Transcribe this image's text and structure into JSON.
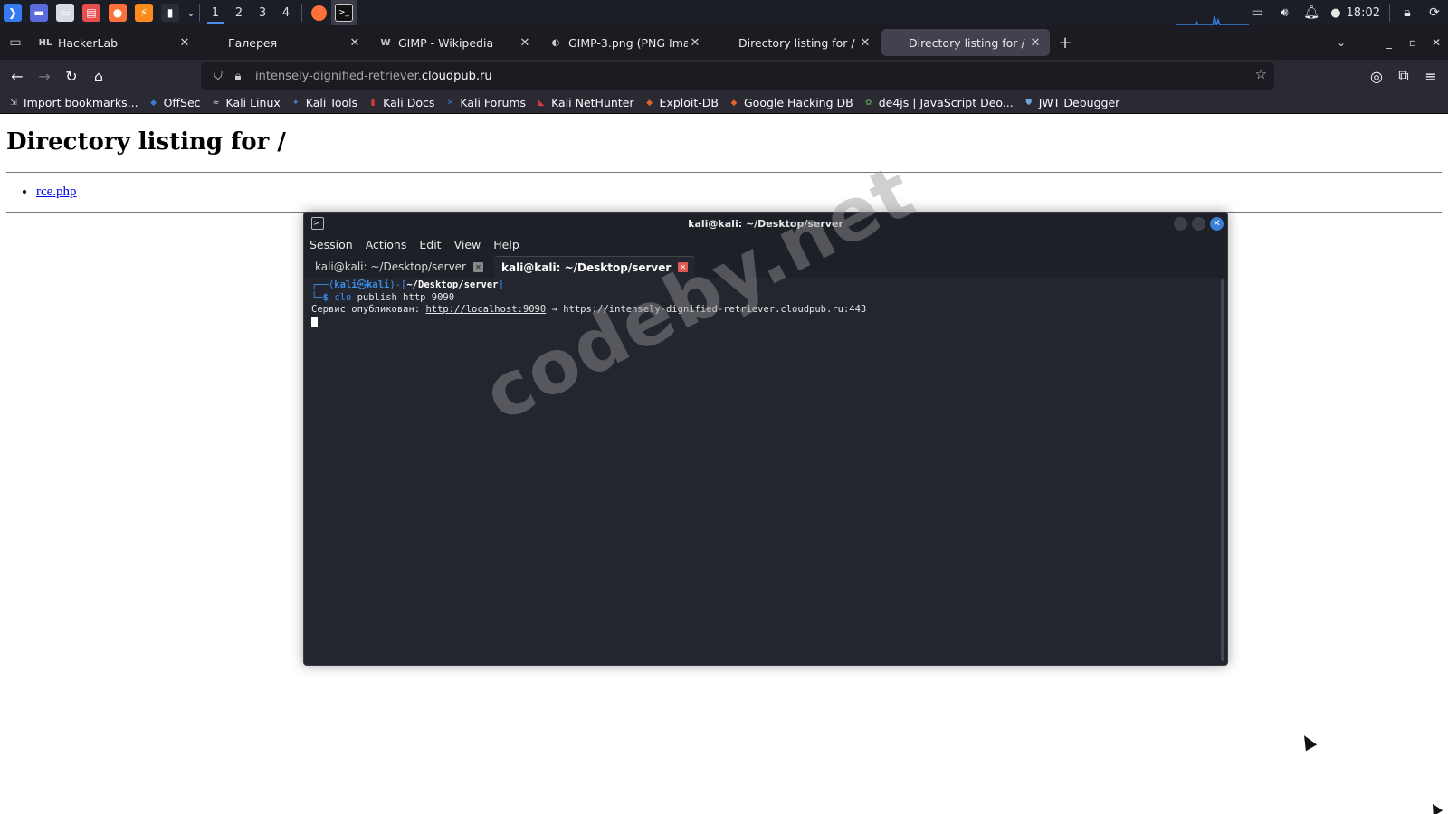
{
  "panel": {
    "launchers": [
      {
        "name": "kali-menu-icon",
        "color": "#367bf0",
        "glyph": "❯"
      },
      {
        "name": "workspace-show-desktop-icon",
        "color": "#5a6bdc",
        "glyph": "▬"
      },
      {
        "name": "file-manager-icon",
        "color": "#d8dbe2",
        "glyph": "▭"
      },
      {
        "name": "text-editor-icon",
        "color": "#e64d4d",
        "glyph": "▤"
      },
      {
        "name": "firefox-icon",
        "color": "#ff7139",
        "glyph": "●"
      },
      {
        "name": "burpsuite-icon",
        "color": "#ff8c1a",
        "glyph": "⚡"
      },
      {
        "name": "terminal-launcher-icon",
        "color": "#2a2d35",
        "glyph": "▮"
      }
    ],
    "workspaces": [
      "1",
      "2",
      "3",
      "4"
    ],
    "active_workspace": 0,
    "time": "18:02"
  },
  "browser": {
    "tabs": [
      {
        "label": "HackerLab",
        "favicon": "HL"
      },
      {
        "label": "Галерея",
        "favicon": ""
      },
      {
        "label": "GIMP - Wikipedia",
        "favicon": "W"
      },
      {
        "label": "GIMP-3.png (PNG Image,",
        "favicon": "◐"
      },
      {
        "label": "Directory listing for /",
        "favicon": ""
      },
      {
        "label": "Directory listing for /",
        "favicon": ""
      }
    ],
    "active_tab": 5,
    "url_prefix": "intensely-dignified-retriever.",
    "url_domain": "cloudpub.ru",
    "bookmarks": [
      {
        "label": "Import bookmarks...",
        "icon": "⇲",
        "color": "transparent"
      },
      {
        "label": "OffSec",
        "icon": "◆",
        "color": "#3d7bd9"
      },
      {
        "label": "Kali Linux",
        "icon": "≈",
        "color": "transparent"
      },
      {
        "label": "Kali Tools",
        "icon": "✦",
        "color": "#5b79d6"
      },
      {
        "label": "Kali Docs",
        "icon": "▮",
        "color": "#d63b3b"
      },
      {
        "label": "Kali Forums",
        "icon": "✕",
        "color": "#3a6fd6"
      },
      {
        "label": "Kali NetHunter",
        "icon": "◣",
        "color": "#d63b3b"
      },
      {
        "label": "Exploit-DB",
        "icon": "◆",
        "color": "#e0642b"
      },
      {
        "label": "Google Hacking DB",
        "icon": "◆",
        "color": "#e0642b"
      },
      {
        "label": "de4js | JavaScript Deo...",
        "icon": "✿",
        "color": "#4b9a4b"
      },
      {
        "label": "JWT Debugger",
        "icon": "⛊",
        "color": "#6aa9d9"
      }
    ]
  },
  "page": {
    "heading": "Directory listing for /",
    "files": [
      "rce.php"
    ]
  },
  "terminal": {
    "title": "kali@kali: ~/Desktop/server",
    "menu": [
      "Session",
      "Actions",
      "Edit",
      "View",
      "Help"
    ],
    "tabs": [
      "kali@kali: ~/Desktop/server",
      "kali@kali: ~/Desktop/server"
    ],
    "active_tab": 1,
    "prompt_user": "kali",
    "prompt_host": "kali",
    "prompt_path": "~/Desktop/server",
    "command": "clo publish http 9090",
    "output_label": "Сервис опубликован:",
    "output_local": "http://localhost:9090",
    "output_arrow": "→",
    "output_remote": "https://intensely-dignified-retriever.cloudpub.ru:443"
  },
  "watermark": "codeby.net"
}
